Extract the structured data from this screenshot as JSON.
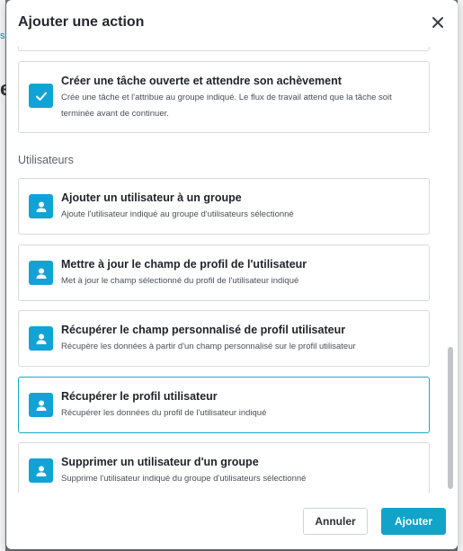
{
  "background": {
    "fragment_1": "s",
    "fragment_2": "e"
  },
  "dialog": {
    "title": "Ajouter une action",
    "close_icon": "close-icon"
  },
  "cards_top": [
    {
      "title": "Créer une tâche ouverte et attendre son achèvement",
      "description": "Crée une tâche et l'attribue au groupe indiqué. Le flux de travail attend que la tâche soit terminée avant de continuer.",
      "icon": "checkmark-icon"
    }
  ],
  "section": {
    "label": "Utilisateurs"
  },
  "cards_users": [
    {
      "title": "Ajouter un utilisateur à un groupe",
      "description": "Ajoute l'utilisateur indiqué au groupe d'utilisateurs sélectionné",
      "icon": "user-icon"
    },
    {
      "title": "Mettre à jour le champ de profil de l'utilisateur",
      "description": "Met à jour le champ sélectionné du profil de l'utilisateur indiqué",
      "icon": "user-icon"
    },
    {
      "title": "Récupérer le champ personnalisé de profil utilisateur",
      "description": "Récupère les données à partir d'un champ personnalisé sur le profil utilisateur",
      "icon": "user-icon"
    },
    {
      "title": "Récupérer le profil utilisateur",
      "description": "Récupérer les données du profil de l'utilisateur indiqué",
      "icon": "user-icon",
      "selected": true
    },
    {
      "title": "Supprimer un utilisateur d'un groupe",
      "description": "Supprime l'utilisateur indiqué du groupe d'utilisateurs sélectionné",
      "icon": "user-icon"
    }
  ],
  "footer": {
    "cancel_label": "Annuler",
    "add_label": "Ajouter"
  },
  "colors": {
    "accent": "#12a3d6",
    "selected_border": "#19a8c9",
    "overlay": "#6f7377"
  }
}
